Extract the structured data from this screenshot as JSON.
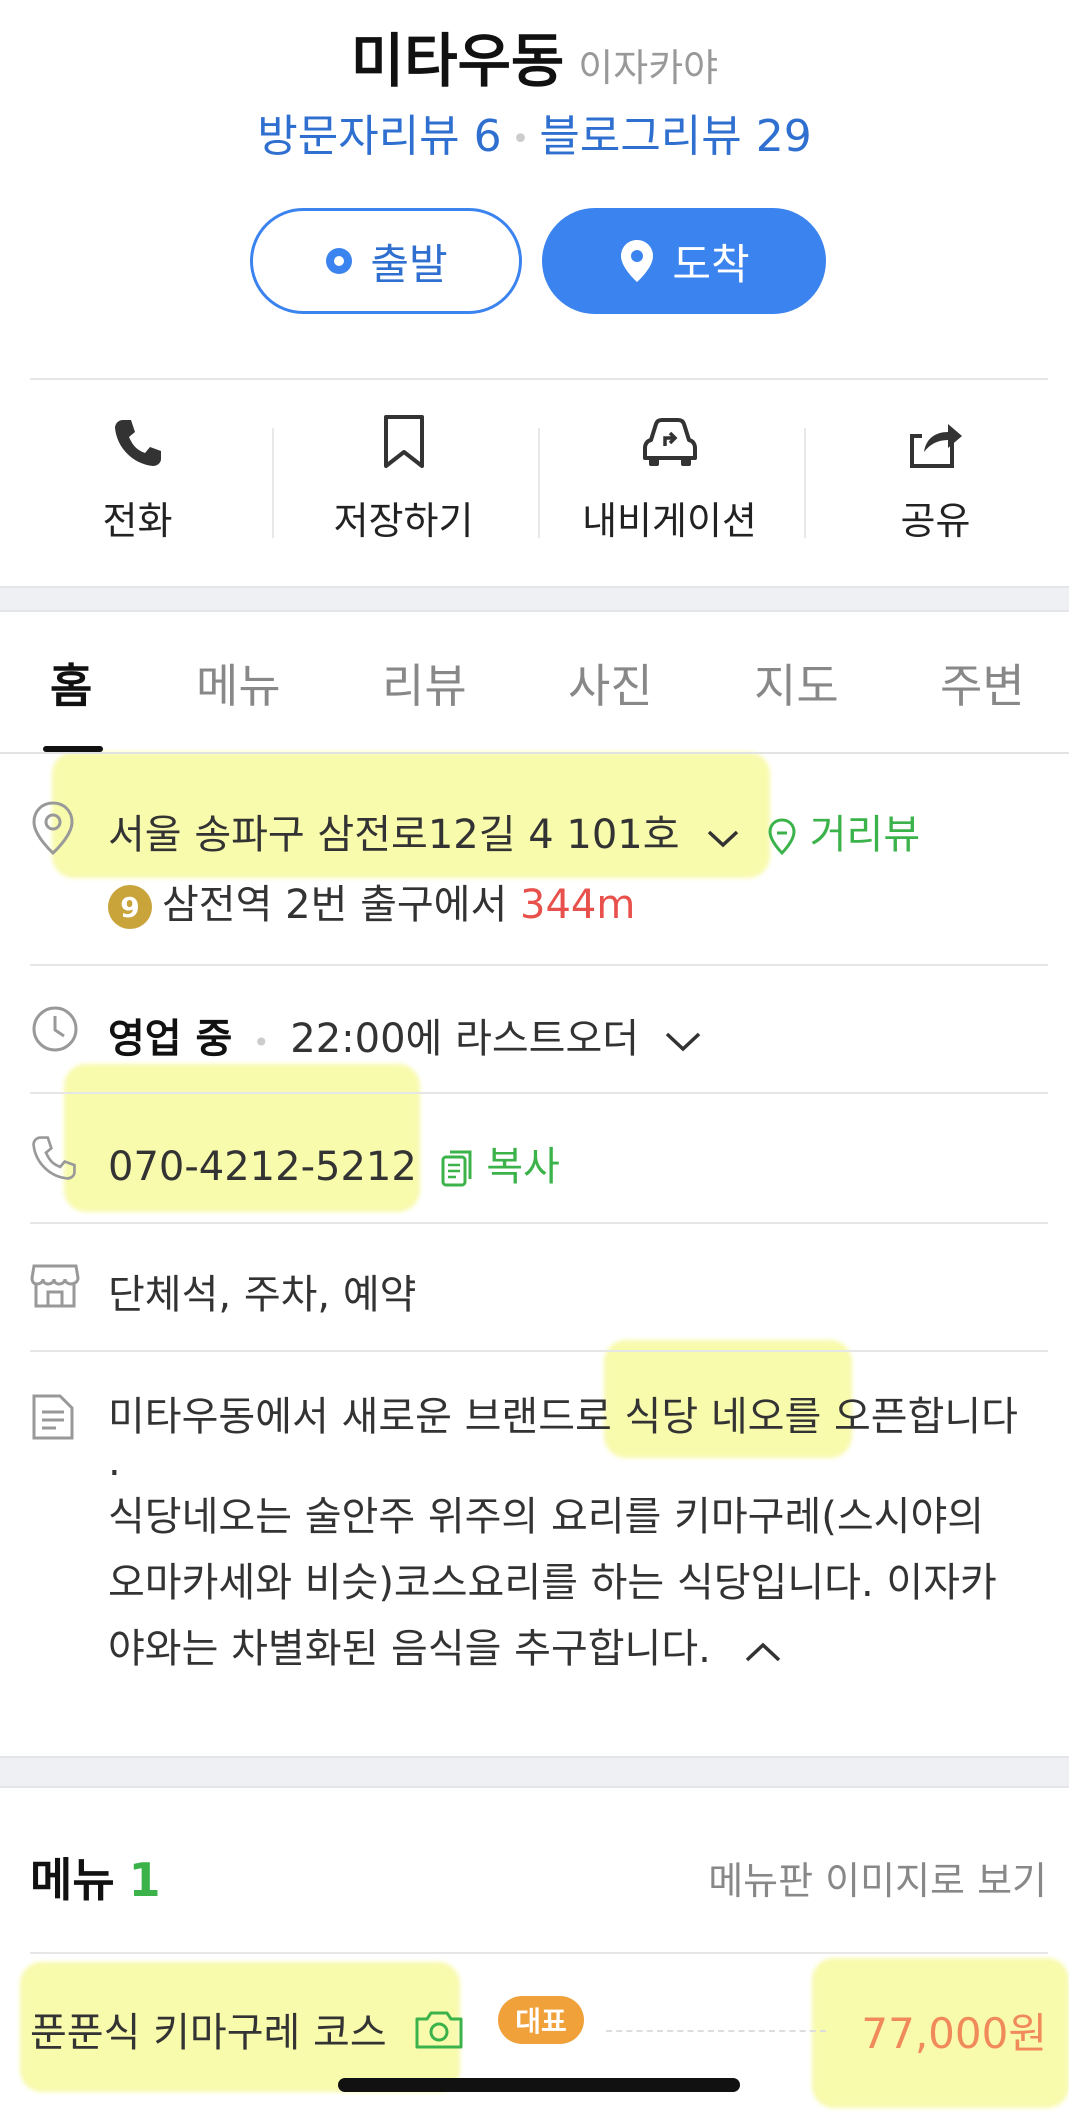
{
  "header": {
    "name": "미타우동",
    "category": "이자카야",
    "visitor_reviews": "방문자리뷰 6",
    "blog_reviews": "블로그리뷰 29",
    "depart_label": "출발",
    "arrive_label": "도착"
  },
  "actions": [
    {
      "label": "전화",
      "icon": "phone-icon"
    },
    {
      "label": "저장하기",
      "icon": "bookmark-icon"
    },
    {
      "label": "내비게이션",
      "icon": "car-navigation-icon"
    },
    {
      "label": "공유",
      "icon": "share-icon"
    }
  ],
  "tabs": [
    "홈",
    "메뉴",
    "리뷰",
    "사진",
    "지도",
    "주변"
  ],
  "active_tab": "홈",
  "info": {
    "address": "서울 송파구 삼전로12길 4 101호",
    "street_view": "거리뷰",
    "subway_line": "9",
    "subway_text": "삼전역 2번 출구에서",
    "subway_distance": "344m",
    "hours_status": "영업 중",
    "hours_detail": "22:00에 라스트오더",
    "phone": "070-4212-5212",
    "copy_label": "복사",
    "facilities": "단체석, 주차, 예약",
    "description_line1": "미타우동에서 새로운 브랜드로 식당 네오를 오픈합니다",
    "description_line2": ".",
    "description_line3": "식당네오는 술안주 위주의 요리를 키마구레(스시야의",
    "description_line4": "오마카세와 비슷)코스요리를 하는 식당입니다. 이자카",
    "description_line5": "야와는 차별화된 음식을 추구합니다."
  },
  "menu": {
    "title": "메뉴",
    "count": "1",
    "view_board": "메뉴판 이미지로 보기",
    "items": [
      {
        "name": "푼푼식 키마구레 코스",
        "badge": "대표",
        "price": "77,000원"
      }
    ]
  },
  "colors": {
    "accent_blue": "#3b83ef",
    "green": "#3cb34a",
    "distance_red": "#e8504b",
    "price_orange": "#f08a5a",
    "badge_orange": "#f0a13a",
    "subway_line9": "#c9a43a",
    "highlight_yellow": "#f6f88a"
  }
}
